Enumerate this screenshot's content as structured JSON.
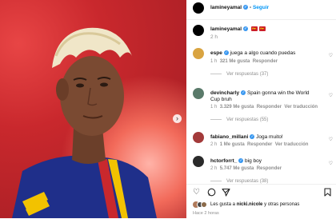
{
  "post": {
    "username": "lamineyamal",
    "follow_label": "Seguir",
    "caption_username": "lamineyamal",
    "caption_flags": [
      "🇪🇸",
      "🇪🇸"
    ],
    "caption_time": "2 h"
  },
  "comments": [
    {
      "user": "espe",
      "text": "juega a algo cuando puedas",
      "time": "1 h",
      "likes": "321 Me gusta",
      "reply": "Responder",
      "view_replies": "Ver respuestas (37)"
    },
    {
      "user": "devincharly",
      "text_line1": "Spain gonna win the World",
      "text_line2": "Cup bruh",
      "time": "1 h",
      "likes": "3.329 Me gusta",
      "reply": "Responder",
      "translate": "Ver traducción",
      "view_replies": "Ver respuestas (55)"
    },
    {
      "user": "fabiano_millani",
      "text": "Joga muito!",
      "time": "2 h",
      "likes": "1 Me gusta",
      "reply": "Responder",
      "translate": "Ver traducción"
    },
    {
      "user": "hctorforrt_",
      "text": "big boy",
      "time": "2 h",
      "likes": "5.747 Me gusta",
      "reply": "Responder",
      "view_replies": "Ver respuestas (38)"
    }
  ],
  "likes_line": {
    "prefix": "Les gusta a",
    "user": "nicki.nicole",
    "suffix": "y otras personas"
  },
  "post_time": "Hace 2 horas",
  "icons": [
    "heart-icon",
    "comment-icon",
    "share-icon",
    "bookmark-icon",
    "next-arrow-icon"
  ]
}
